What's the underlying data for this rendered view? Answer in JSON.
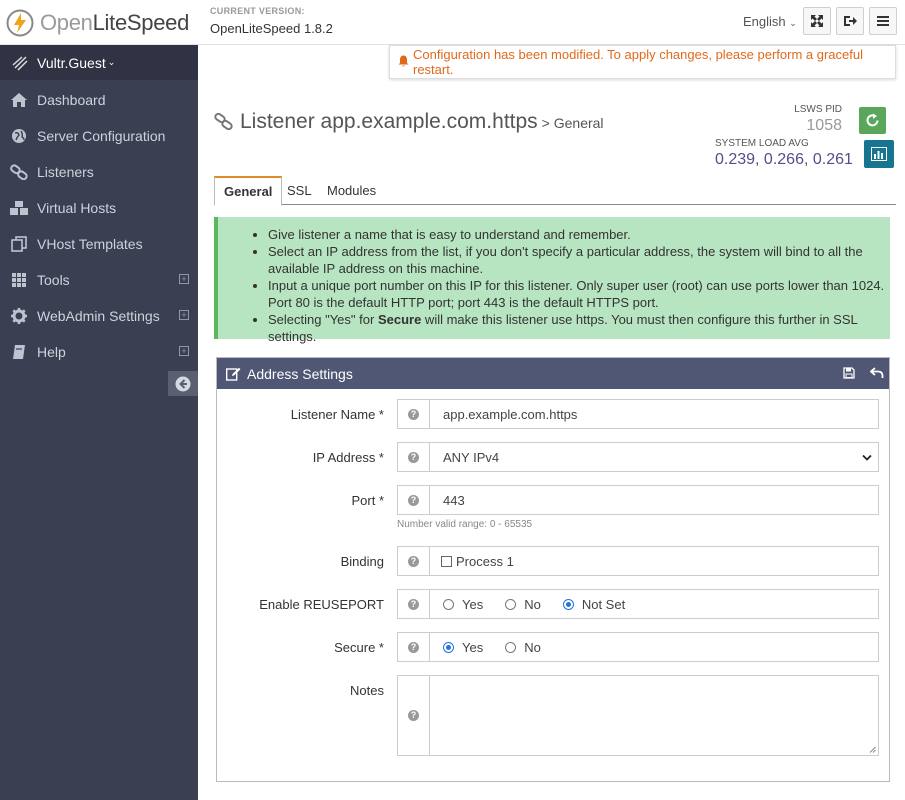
{
  "header": {
    "brand_light": "Open",
    "brand_dark": "LiteSpeed",
    "version_label": "CURRENT VERSION:",
    "version_value": "OpenLiteSpeed 1.8.2",
    "language": "English"
  },
  "sidebar": {
    "user": "Vultr.Guest",
    "items": [
      {
        "label": "Dashboard",
        "icon": "home-icon"
      },
      {
        "label": "Server Configuration",
        "icon": "globe-icon"
      },
      {
        "label": "Listeners",
        "icon": "link-icon"
      },
      {
        "label": "Virtual Hosts",
        "icon": "cubes-icon"
      },
      {
        "label": "VHost Templates",
        "icon": "copy-icon"
      },
      {
        "label": "Tools",
        "icon": "grid-icon"
      },
      {
        "label": "WebAdmin Settings",
        "icon": "gear-icon"
      },
      {
        "label": "Help",
        "icon": "book-icon"
      }
    ]
  },
  "alert": {
    "message": "Configuration has been modified. To apply changes, please perform a graceful restart."
  },
  "page": {
    "title": "Listener app.example.com.https",
    "subtitle": "> General",
    "pid_label": "LSWS PID",
    "pid_value": "1058",
    "load_label": "SYSTEM LOAD AVG",
    "load_value": "0.239, 0.266, 0.261"
  },
  "tabs": [
    "General",
    "SSL",
    "Modules"
  ],
  "info": {
    "items": [
      "Give listener a name that is easy to understand and remember.",
      "Select an IP address from the list, if you don't specify a particular address, the system will bind to all the available IP address on this machine.",
      "Input a unique port number on this IP for this listener. Only super user (root) can use ports lower than 1024. Port 80 is the default HTTP port; port 443 is the default HTTPS port."
    ],
    "last_prefix": "Selecting \"Yes\" for ",
    "last_bold": "Secure",
    "last_suffix": " will make this listener use https. You must then configure this further in SSL settings."
  },
  "panel": {
    "title": "Address Settings",
    "fields": {
      "name_label": "Listener Name *",
      "name_value": "app.example.com.https",
      "ip_label": "IP Address *",
      "ip_value": "ANY IPv4",
      "port_label": "Port *",
      "port_value": "443",
      "port_hint": "Number valid range: 0 - 65535",
      "binding_label": "Binding",
      "binding_option": "Process 1",
      "reuse_label": "Enable REUSEPORT",
      "reuse_options": [
        "Yes",
        "No",
        "Not Set"
      ],
      "reuse_selected": "Not Set",
      "secure_label": "Secure *",
      "secure_options": [
        "Yes",
        "No"
      ],
      "secure_selected": "Yes",
      "notes_label": "Notes",
      "notes_value": ""
    }
  }
}
